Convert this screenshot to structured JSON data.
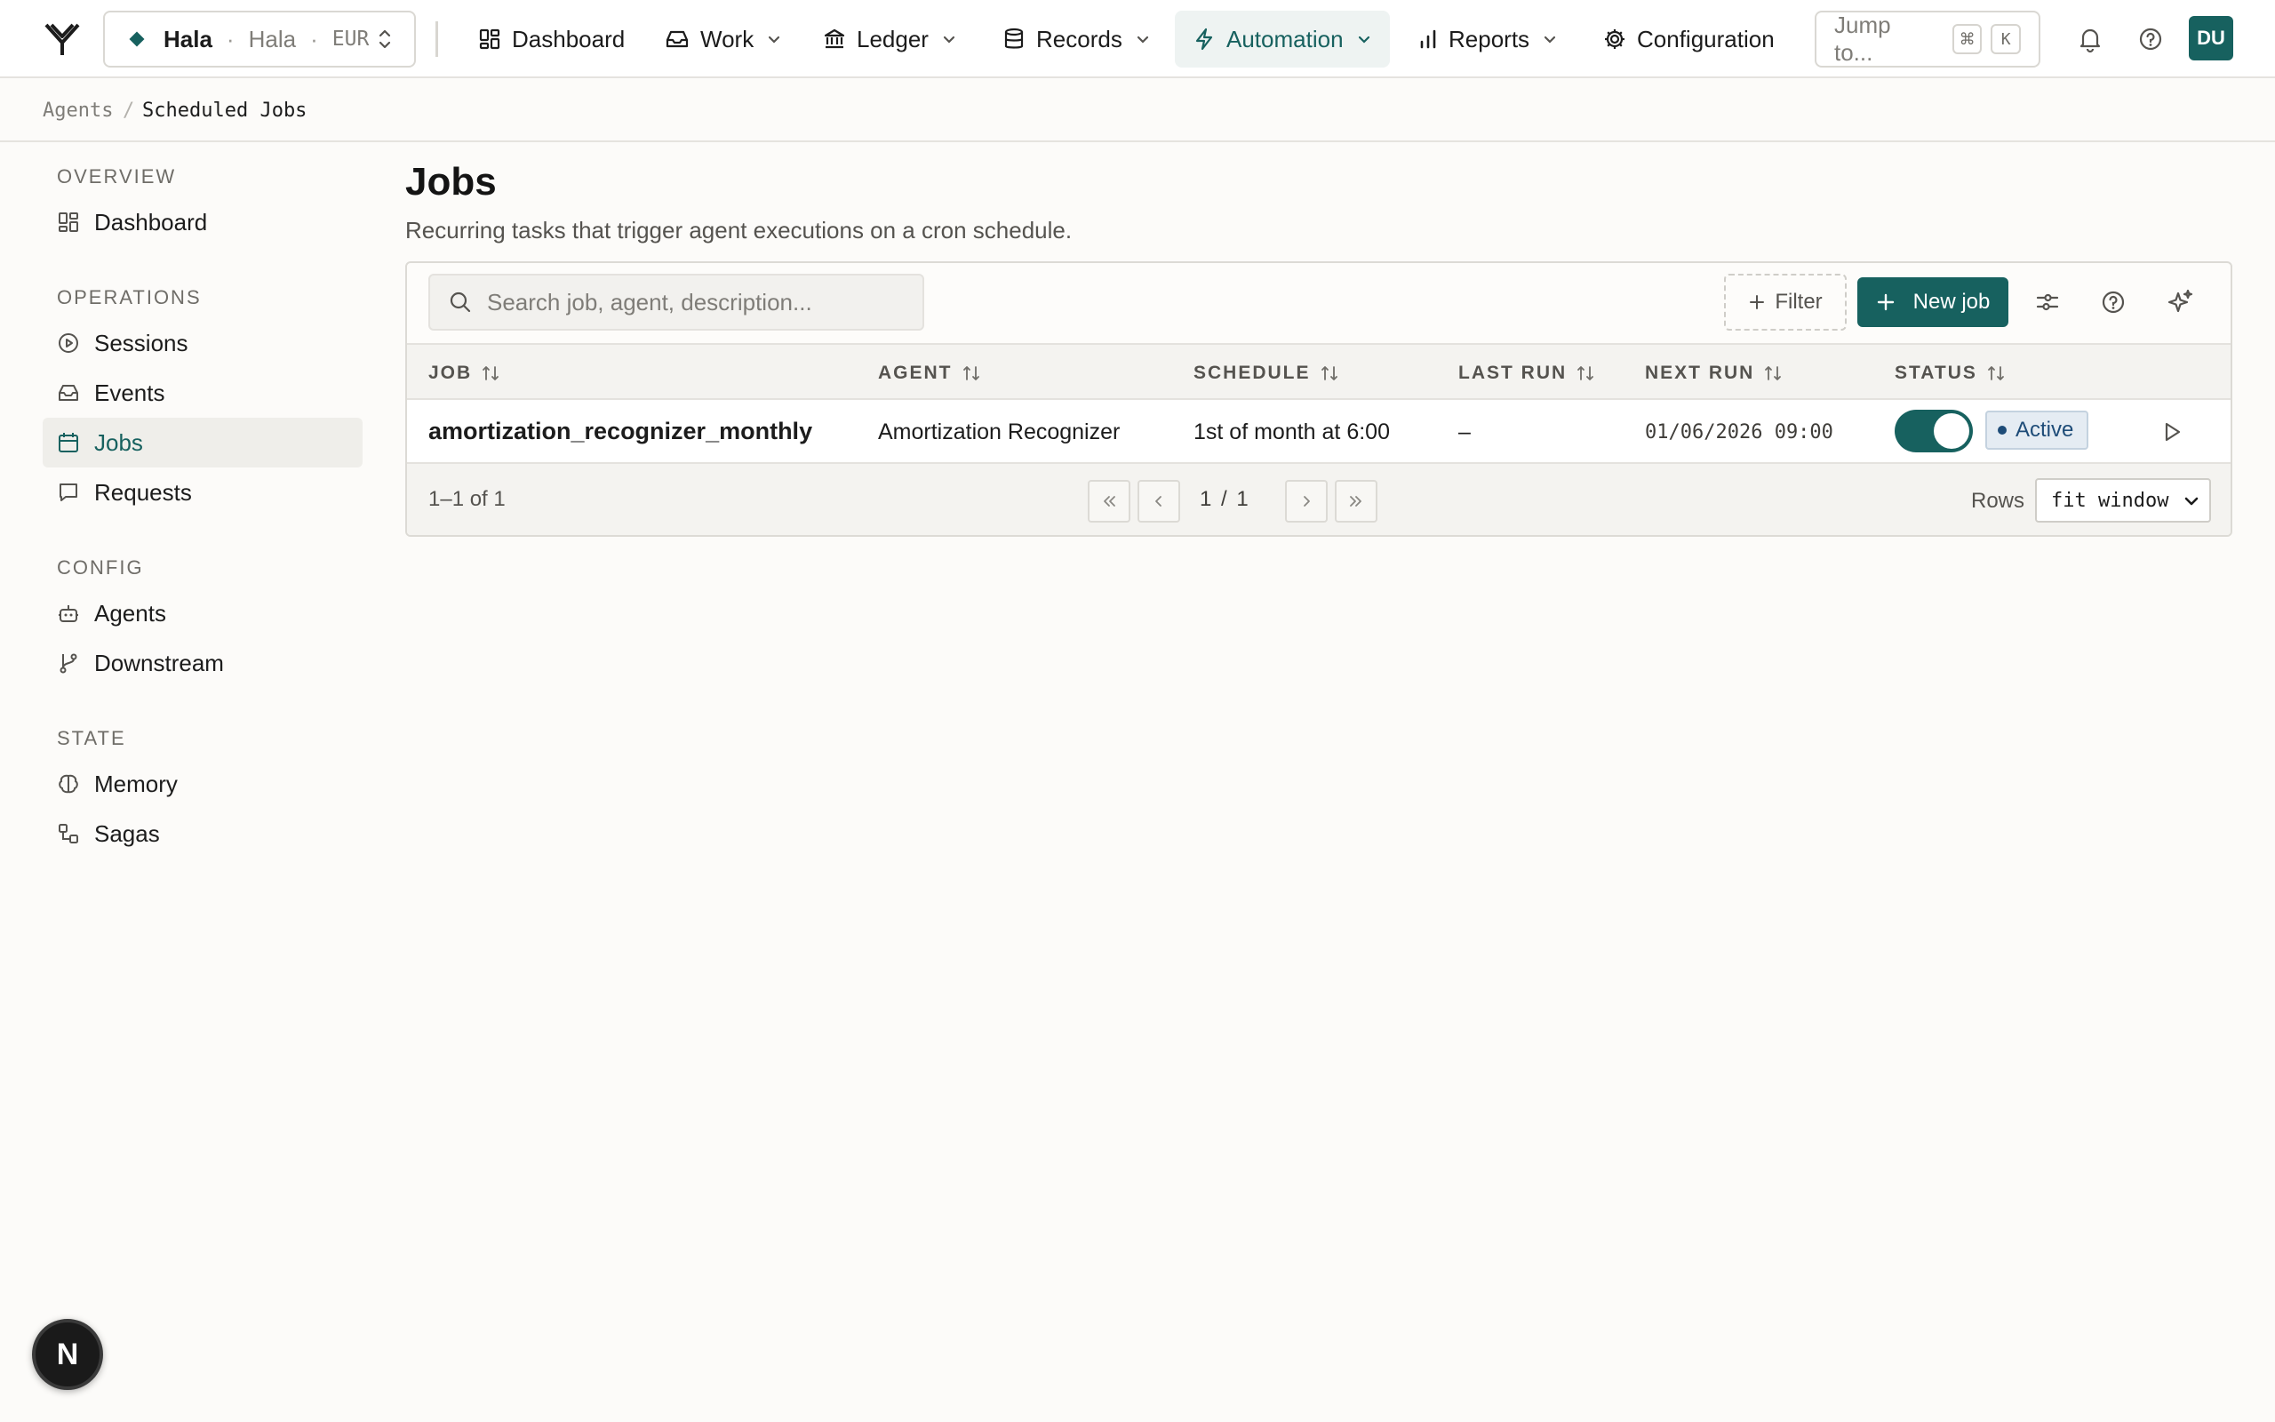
{
  "org": {
    "name": "Hala",
    "entity": "Hala",
    "currency": "EUR"
  },
  "nav": [
    {
      "label": "Dashboard",
      "icon": "grid-icon"
    },
    {
      "label": "Work",
      "icon": "inbox-icon"
    },
    {
      "label": "Ledger",
      "icon": "bank-icon"
    },
    {
      "label": "Records",
      "icon": "database-icon"
    },
    {
      "label": "Automation",
      "icon": "bolt-icon",
      "active": true
    },
    {
      "label": "Reports",
      "icon": "bar-chart-icon"
    },
    {
      "label": "Configuration",
      "icon": "gear-icon"
    }
  ],
  "jump": {
    "label": "Jump to...",
    "key1": "⌘",
    "key2": "K"
  },
  "user": {
    "initials": "DU"
  },
  "breadcrumb": {
    "parent": "Agents",
    "separator": "/",
    "current": "Scheduled Jobs"
  },
  "sidebar": {
    "sections": [
      {
        "title": "OVERVIEW",
        "items": [
          {
            "label": "Dashboard",
            "icon": "grid-icon"
          }
        ]
      },
      {
        "title": "OPERATIONS",
        "items": [
          {
            "label": "Sessions",
            "icon": "play-circle-icon"
          },
          {
            "label": "Events",
            "icon": "inbox-icon"
          },
          {
            "label": "Jobs",
            "icon": "calendar-icon",
            "active": true
          },
          {
            "label": "Requests",
            "icon": "message-icon"
          }
        ]
      },
      {
        "title": "CONFIG",
        "items": [
          {
            "label": "Agents",
            "icon": "bot-icon"
          },
          {
            "label": "Downstream",
            "icon": "git-branch-icon"
          }
        ]
      },
      {
        "title": "STATE",
        "items": [
          {
            "label": "Memory",
            "icon": "brain-icon"
          },
          {
            "label": "Sagas",
            "icon": "workflow-icon"
          }
        ]
      }
    ]
  },
  "page": {
    "title": "Jobs",
    "description": "Recurring tasks that trigger agent executions on a cron schedule."
  },
  "toolbar": {
    "search_placeholder": "Search job, agent, description...",
    "filter_label": "Filter",
    "new_job_label": "New job"
  },
  "table": {
    "columns": [
      "JOB",
      "AGENT",
      "SCHEDULE",
      "LAST RUN",
      "NEXT RUN",
      "STATUS"
    ],
    "rows": [
      {
        "job": "amortization_recognizer_monthly",
        "agent": "Amortization Recognizer",
        "schedule": "1st of month at 6:00",
        "last_run": "–",
        "next_run": "01/06/2026 09:00",
        "enabled": true,
        "status": "Active"
      }
    ]
  },
  "pagination": {
    "range": "1–1 of 1",
    "page": "1 / 1",
    "rows_label": "Rows",
    "rows_value": "fit window"
  },
  "colors": {
    "accent": "#17615f",
    "status_bg": "#e5ecf3",
    "status_text": "#1e4c78"
  },
  "dev_badge": "N"
}
